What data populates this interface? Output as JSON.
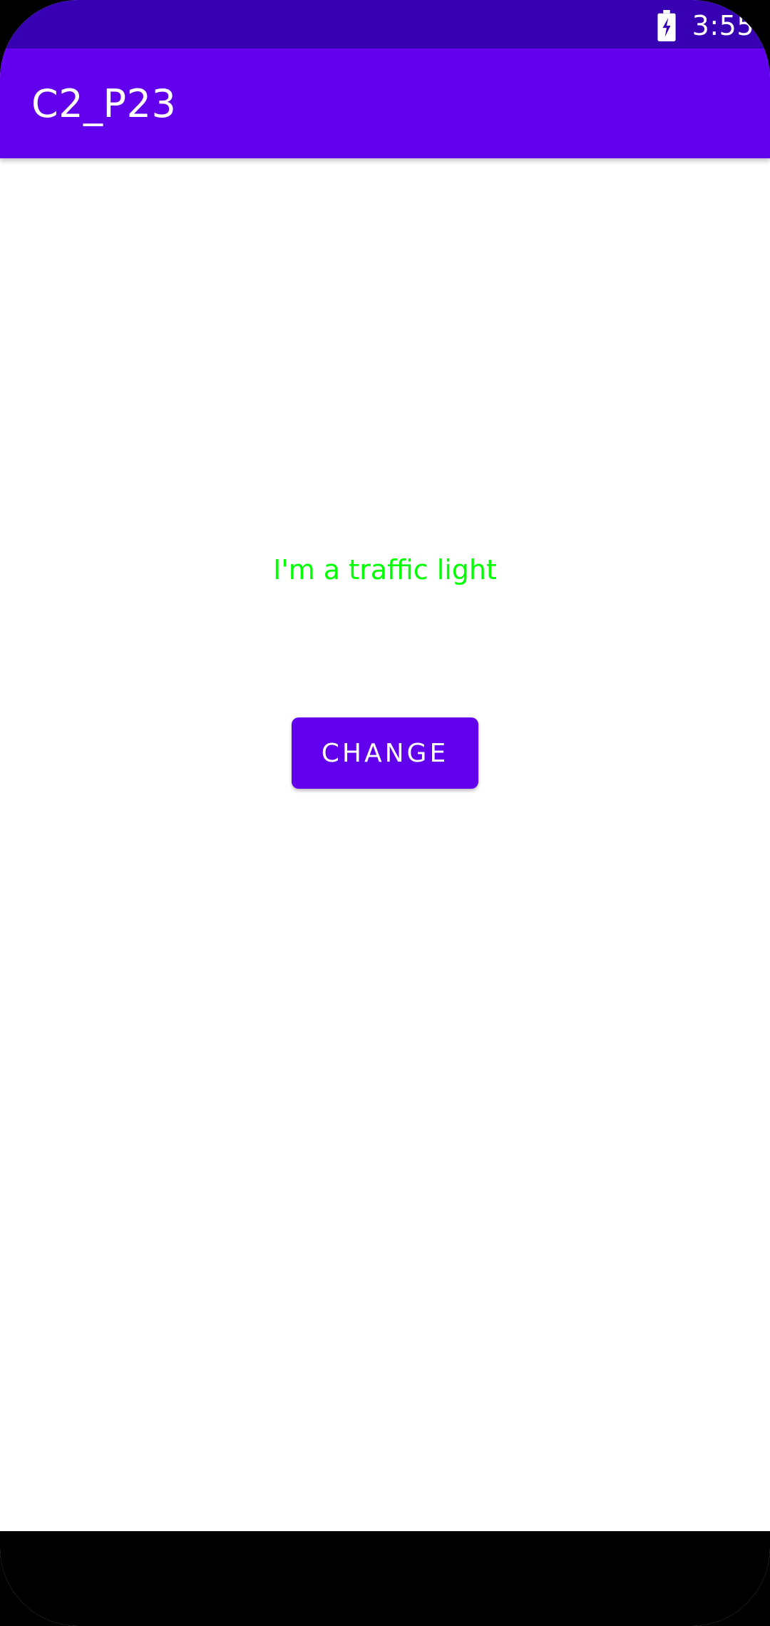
{
  "status_bar": {
    "time": "3:55",
    "battery_icon": "battery-charging-icon",
    "background_color": "#3700B3"
  },
  "app_bar": {
    "title": "C2_P23",
    "background_color": "#6200EE"
  },
  "main": {
    "message": "I'm a traffic light",
    "message_color": "#00FF00",
    "change_button_label": "CHANGE"
  }
}
